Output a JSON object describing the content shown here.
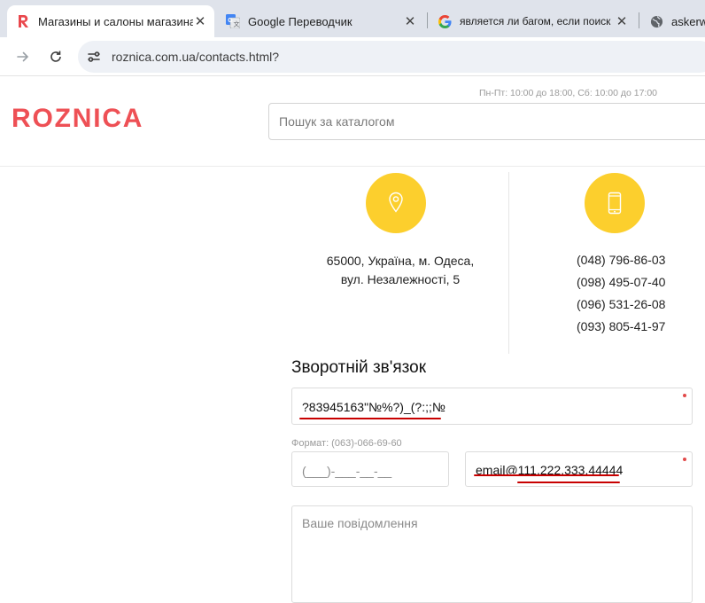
{
  "browser": {
    "tabs": [
      {
        "title": "Магазины и салоны магазина",
        "favicon": "roznica-r-icon",
        "active": true
      },
      {
        "title": "Google Переводчик",
        "favicon": "google-translate-icon",
        "active": false
      },
      {
        "title": "является ли багом, если поиск",
        "favicon": "google-icon",
        "active": false
      },
      {
        "title": "askerwe",
        "favicon": "globe-icon",
        "active": false
      }
    ],
    "close_glyph": "✕",
    "url": "roznica.com.ua/contacts.html?"
  },
  "header": {
    "logo": "ROZNICA",
    "hours": "Пн-Пт: 10:00 до 18:00, Сб: 10:00 до 17:00",
    "search_placeholder": "Пошук за каталогом"
  },
  "contacts": {
    "address_line1": "65000, Україна, м. Одеса,",
    "address_line2": "вул. Незалежності, 5",
    "phones": [
      "(048) 796-86-03",
      "(098) 495-07-40",
      "(096) 531-26-08",
      "(093) 805-41-97"
    ],
    "icons": [
      "location-pin-icon",
      "mobile-phone-icon"
    ]
  },
  "feedback": {
    "title": "Зворотній зв'язок",
    "name_value": "?83945163\"№%?)_(?:;;№",
    "phone_hint": "Формат: (063)-066-69-60",
    "phone_mask": "(___)-___-__-__",
    "email_value": "email@111.222.333.44444",
    "message_placeholder": "Ваше повідомлення"
  },
  "colors": {
    "brand": "#ee5055",
    "accent": "#fccf2d",
    "annotation": "#c80000",
    "tab_strip": "#dfe3eb"
  }
}
